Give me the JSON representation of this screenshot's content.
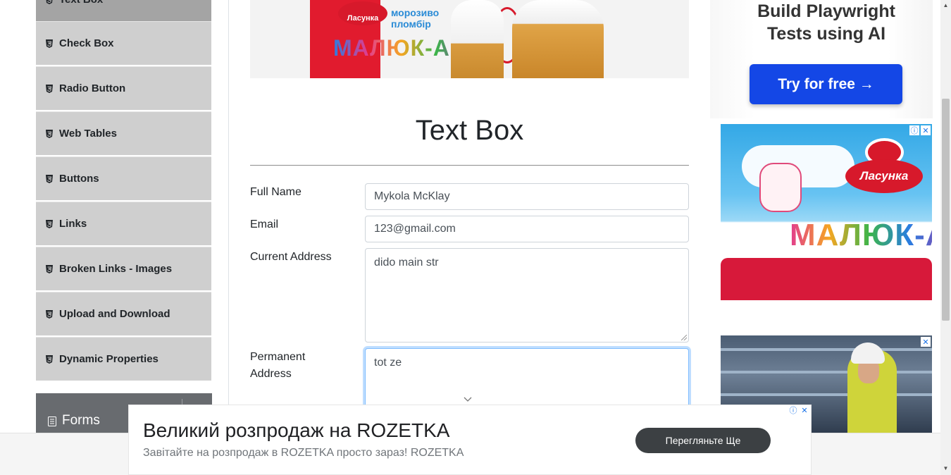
{
  "sidebar": {
    "items": [
      {
        "label": "Text Box"
      },
      {
        "label": "Check Box"
      },
      {
        "label": "Radio Button"
      },
      {
        "label": "Web Tables"
      },
      {
        "label": "Buttons"
      },
      {
        "label": "Links"
      },
      {
        "label": "Broken Links - Images"
      },
      {
        "label": "Upload and Download"
      },
      {
        "label": "Dynamic Properties"
      }
    ],
    "forms_group": {
      "label": "Forms"
    }
  },
  "banner": {
    "brand": "Ласунка",
    "product_note_1": "морозиво",
    "product_note_2": "пломбір",
    "product_name": "МАЛЮК-АМ"
  },
  "main": {
    "title": "Text Box",
    "form": {
      "full_name": {
        "label": "Full Name",
        "value": "Mykola McKlay"
      },
      "email": {
        "label": "Email",
        "value": "123@gmail.com"
      },
      "current_address": {
        "label": "Current Address",
        "value": "dido main str"
      },
      "permanent_address": {
        "label_line1": "Permanent",
        "label_line2": "Address",
        "value": "tot ze"
      }
    }
  },
  "ads": {
    "top": {
      "headline_line1": "Build Playwright",
      "headline_line2": "Tests using AI",
      "cta": "Try for free →"
    },
    "mid": {
      "logo": "Ласунка",
      "product": "МАЛЮК-А"
    },
    "bottom": {
      "headline": "Великий розпродаж на ROZETKA",
      "subtext": "Завітайте на розпродаж в ROZETKA просто зараз! ROZETKA",
      "button": "Перегляньте Ще"
    },
    "badge_info": "ⓘ",
    "badge_close": "✕"
  },
  "colors": {
    "sidebar_item_bg": "#cfcfcf",
    "sidebar_active_bg": "#a4a4a4",
    "group_header_bg": "#686b6f",
    "cta_blue": "#1447e6",
    "focus_blue": "#80bdff"
  }
}
